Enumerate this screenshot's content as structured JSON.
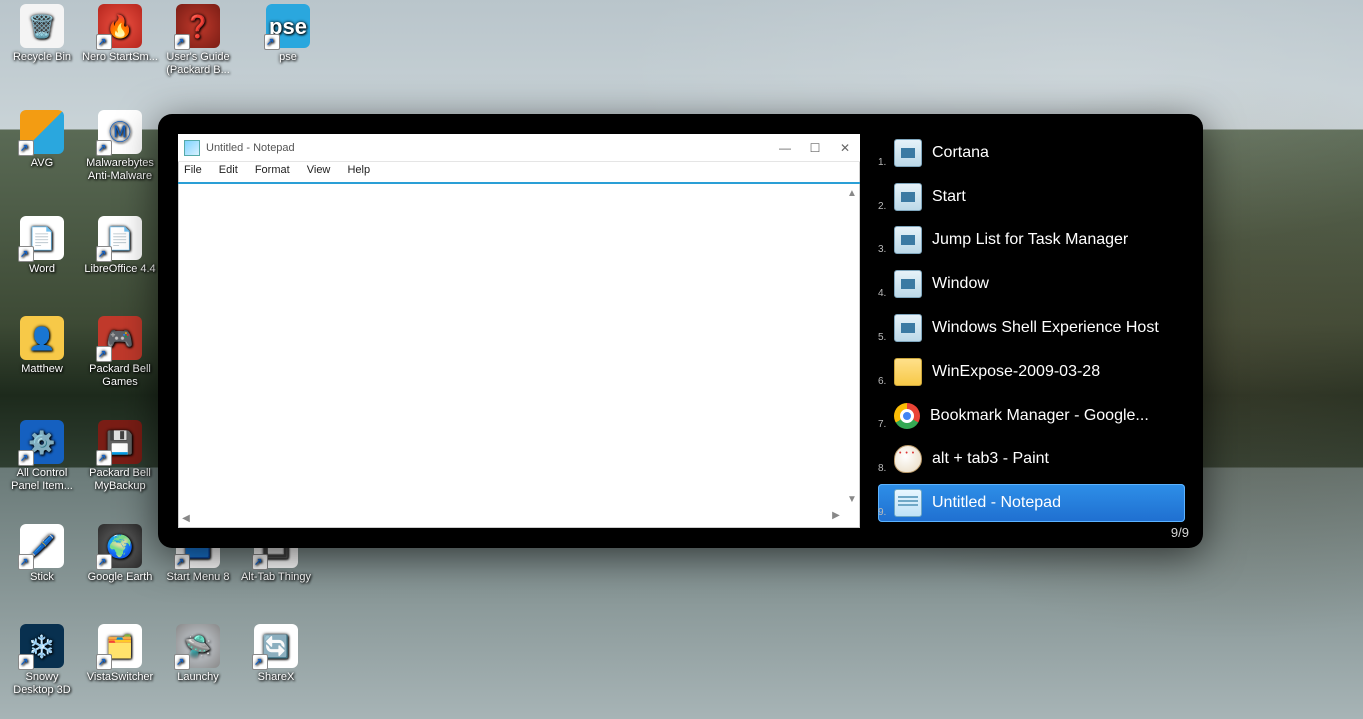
{
  "desktop_icons": [
    {
      "label": "Recycle Bin"
    },
    {
      "label": "Nero StartSm..."
    },
    {
      "label": "User's Guide (Packard B..."
    },
    {
      "label": "pse"
    },
    {
      "label": "AVG"
    },
    {
      "label": "Malwarebytes Anti-Malware"
    },
    {
      "label": "Word"
    },
    {
      "label": "LibreOffice 4.4"
    },
    {
      "label": "Matthew"
    },
    {
      "label": "Packard Bell Games"
    },
    {
      "label": "All Control Panel Item..."
    },
    {
      "label": "Packard Bell MyBackup"
    },
    {
      "label": "Stick"
    },
    {
      "label": "Google Earth"
    },
    {
      "label": "Start Menu 8"
    },
    {
      "label": "Alt-Tab Thingy"
    },
    {
      "label": "Snowy Desktop 3D"
    },
    {
      "label": "VistaSwitcher"
    },
    {
      "label": "Launchy"
    },
    {
      "label": "ShareX"
    }
  ],
  "notepad": {
    "title": "Untitled - Notepad",
    "menu": {
      "file": "File",
      "edit": "Edit",
      "format": "Format",
      "view": "View",
      "help": "Help"
    }
  },
  "switcher": {
    "items": [
      {
        "n": "1.",
        "label": "Cortana",
        "icon": "win"
      },
      {
        "n": "2.",
        "label": "Start",
        "icon": "win"
      },
      {
        "n": "3.",
        "label": "Jump List for Task Manager",
        "icon": "win"
      },
      {
        "n": "4.",
        "label": "Window",
        "icon": "win"
      },
      {
        "n": "5.",
        "label": "Windows Shell Experience Host",
        "icon": "win"
      },
      {
        "n": "6.",
        "label": "WinExpose-2009-03-28",
        "icon": "folder"
      },
      {
        "n": "7.",
        "label": "Bookmark Manager - Google...",
        "icon": "chrome"
      },
      {
        "n": "8.",
        "label": "alt + tab3 - Paint",
        "icon": "paint"
      },
      {
        "n": "9.",
        "label": "Untitled - Notepad",
        "icon": "notepad",
        "selected": true
      }
    ],
    "counter": "9/9"
  }
}
